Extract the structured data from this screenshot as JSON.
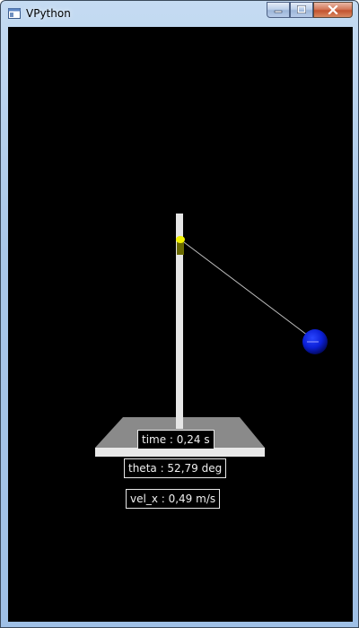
{
  "window": {
    "title": "VPython",
    "icon": "vpython-app-icon",
    "controls": [
      "minimize-icon",
      "maximize-icon",
      "close-icon"
    ]
  },
  "scene": {
    "background_color": "#000000",
    "pole_color": "#e6e6e6",
    "base_color": "#8a8a8a",
    "pivot_color": "#e6e600",
    "string_color": "#bdbdbd",
    "bob_color": "#0b1fd6"
  },
  "labels": {
    "time": "time : 0,24 s",
    "theta": "theta : 52,79 deg",
    "vel_x": "vel_x : 0,49 m/s"
  }
}
